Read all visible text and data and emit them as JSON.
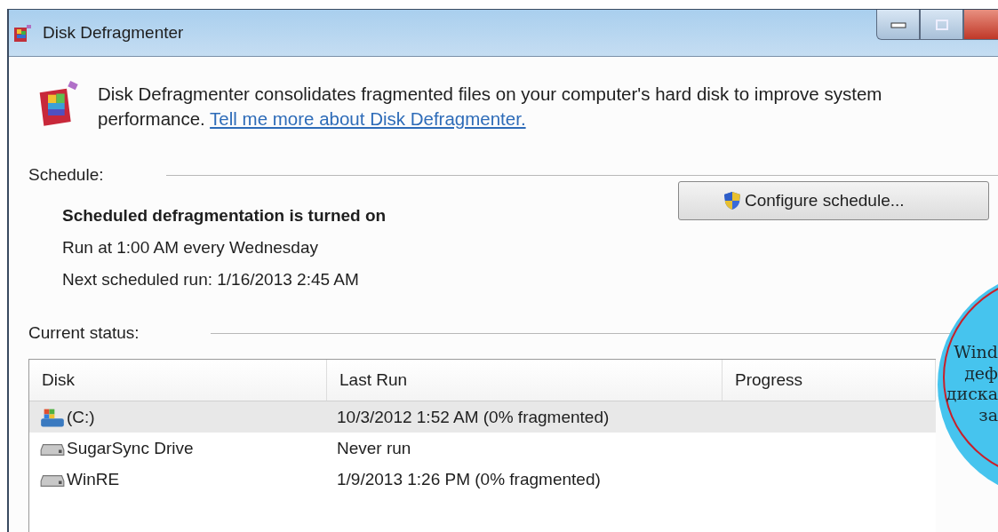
{
  "window": {
    "title": "Disk Defragmenter"
  },
  "intro": {
    "text": "Disk Defragmenter consolidates fragmented files on your computer's hard disk to improve system performance.",
    "link": "Tell me more about Disk Defragmenter."
  },
  "schedule": {
    "label": "Schedule:",
    "status": "Scheduled defragmentation is turned on",
    "lines": [
      "Run at 1:00 AM every Wednesday",
      "Next scheduled run: 1/16/2013 2:45 AM"
    ],
    "button": "Configure schedule..."
  },
  "current_status": {
    "label": "Current status:",
    "columns": [
      "Disk",
      "Last Run",
      "Progress"
    ],
    "rows": [
      {
        "kind": "system",
        "disk": "(C:)",
        "last_run": "10/3/2012 1:52 AM (0% fragmented)",
        "selected": true
      },
      {
        "kind": "drive",
        "disk": "SugarSync Drive",
        "last_run": "Never run",
        "selected": false
      },
      {
        "kind": "drive",
        "disk": "WinRE",
        "last_run": "1/9/2013 1:26 PM (0% fragmented)",
        "selected": false
      }
    ]
  },
  "callout": {
    "lines": [
      "Wind",
      "деф",
      "диска",
      "за"
    ]
  }
}
